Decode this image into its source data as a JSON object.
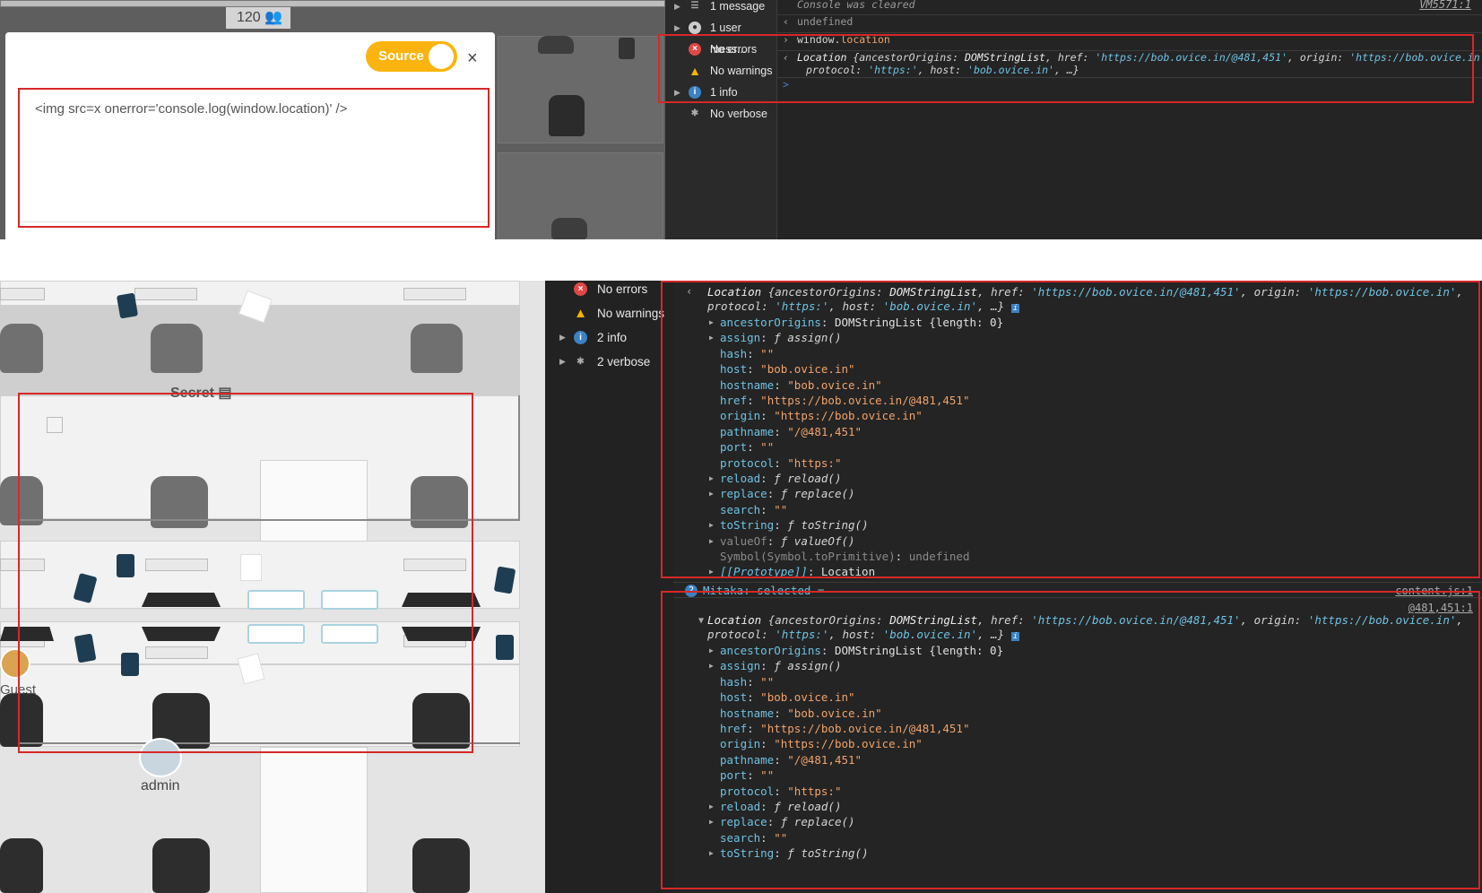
{
  "top": {
    "counter": "120",
    "editor": {
      "source_label": "Source",
      "close": "×",
      "code": "<img src=x onerror='console.log(window.location)' />"
    },
    "sidebar": [
      {
        "label": "1 message",
        "icon": "list-icon",
        "caret": true
      },
      {
        "label": "1 user mess...",
        "icon": "user-icon",
        "caret": true
      },
      {
        "label": "No errors",
        "icon": "error-icon",
        "caret": false
      },
      {
        "label": "No warnings",
        "icon": "warning-icon",
        "caret": false
      },
      {
        "label": "1 info",
        "icon": "info-icon",
        "caret": true
      },
      {
        "label": "No verbose",
        "icon": "bug-icon",
        "caret": false
      }
    ],
    "console": {
      "cleared": "Console was cleared",
      "cleared_src": "VM5571:1",
      "undefined": "undefined",
      "input_obj": "window.",
      "input_prop": "location",
      "result_line1_a": "Location",
      "result_line1_b": "{ancestorOrigins: ",
      "result_line1_c": "DOMStringList",
      "result_line1_d": ", href: ",
      "result_line1_e": "'https://bob.ovice.in/@481,451'",
      "result_line1_f": ", origin: ",
      "result_line1_g": "'https://bob.ovice.in'",
      "result_line1_h": ",",
      "result_line2_a": "protocol: ",
      "result_line2_b": "'https:'",
      "result_line2_c": ", host: ",
      "result_line2_d": "'bob.ovice.in'",
      "result_line2_e": ", …}",
      "prompt": ">"
    }
  },
  "bottom": {
    "office": {
      "secret_label": "Secret",
      "guest_label": "Guest",
      "admin_label": "admin"
    },
    "sidebar": [
      {
        "label": "No errors",
        "icon": "error-icon",
        "caret": false
      },
      {
        "label": "No warnings",
        "icon": "warning-icon",
        "caret": false
      },
      {
        "label": "2 info",
        "icon": "info-icon",
        "caret": true
      },
      {
        "label": "2 verbose",
        "icon": "bug-icon",
        "caret": true
      }
    ],
    "group_label": "Mitaka: selected =",
    "group_count": "2",
    "group_src": "content.js:1",
    "second_src": "@481,451:1",
    "summary": {
      "a": "Location",
      "b": "{ancestorOrigins: ",
      "c": "DOMStringList",
      "d": ", href: ",
      "e": "'https://bob.ovice.in/@481,451'",
      "f": ", origin: ",
      "g": "'https://bob.ovice.in'",
      "h": ",",
      "p1": "protocol: ",
      "p2": "'https:'",
      "p3": ", host: ",
      "p4": "'bob.ovice.in'",
      "p5": ", …}"
    },
    "props_block1": [
      {
        "key": "ancestorOrigins",
        "sep": ": ",
        "val": "DOMStringList {length: 0}",
        "kind": "obj",
        "caret": true
      },
      {
        "key": "assign",
        "sep": ": ",
        "val": "ƒ assign()",
        "kind": "fn",
        "caret": true
      },
      {
        "key": "hash",
        "sep": ": ",
        "val": "\"\"",
        "kind": "str",
        "caret": false
      },
      {
        "key": "host",
        "sep": ": ",
        "val": "\"bob.ovice.in\"",
        "kind": "str",
        "caret": false
      },
      {
        "key": "hostname",
        "sep": ": ",
        "val": "\"bob.ovice.in\"",
        "kind": "str",
        "caret": false
      },
      {
        "key": "href",
        "sep": ": ",
        "val": "\"https://bob.ovice.in/@481,451\"",
        "kind": "str",
        "caret": false
      },
      {
        "key": "origin",
        "sep": ": ",
        "val": "\"https://bob.ovice.in\"",
        "kind": "str",
        "caret": false
      },
      {
        "key": "pathname",
        "sep": ": ",
        "val": "\"/@481,451\"",
        "kind": "str",
        "caret": false
      },
      {
        "key": "port",
        "sep": ": ",
        "val": "\"\"",
        "kind": "str",
        "caret": false
      },
      {
        "key": "protocol",
        "sep": ": ",
        "val": "\"https:\"",
        "kind": "str",
        "caret": false
      },
      {
        "key": "reload",
        "sep": ": ",
        "val": "ƒ reload()",
        "kind": "fn",
        "caret": true
      },
      {
        "key": "replace",
        "sep": ": ",
        "val": "ƒ replace()",
        "kind": "fn",
        "caret": true
      },
      {
        "key": "search",
        "sep": ": ",
        "val": "\"\"",
        "kind": "str",
        "caret": false
      },
      {
        "key": "toString",
        "sep": ": ",
        "val": "ƒ toString()",
        "kind": "fn",
        "caret": true
      },
      {
        "key": "valueOf",
        "sep": ": ",
        "val": "ƒ valueOf()",
        "kind": "fn-dim",
        "caret": true
      },
      {
        "key": "Symbol(Symbol.toPrimitive)",
        "sep": ": ",
        "val": "undefined",
        "kind": "dim",
        "caret": false
      },
      {
        "key": "[[Prototype]]",
        "sep": ": ",
        "val": "Location",
        "kind": "proto",
        "caret": true
      }
    ],
    "props_block2": [
      {
        "key": "ancestorOrigins",
        "sep": ": ",
        "val": "DOMStringList {length: 0}",
        "kind": "obj",
        "caret": true
      },
      {
        "key": "assign",
        "sep": ": ",
        "val": "ƒ assign()",
        "kind": "fn",
        "caret": true
      },
      {
        "key": "hash",
        "sep": ": ",
        "val": "\"\"",
        "kind": "str",
        "caret": false
      },
      {
        "key": "host",
        "sep": ": ",
        "val": "\"bob.ovice.in\"",
        "kind": "str",
        "caret": false
      },
      {
        "key": "hostname",
        "sep": ": ",
        "val": "\"bob.ovice.in\"",
        "kind": "str",
        "caret": false
      },
      {
        "key": "href",
        "sep": ": ",
        "val": "\"https://bob.ovice.in/@481,451\"",
        "kind": "str",
        "caret": false
      },
      {
        "key": "origin",
        "sep": ": ",
        "val": "\"https://bob.ovice.in\"",
        "kind": "str",
        "caret": false
      },
      {
        "key": "pathname",
        "sep": ": ",
        "val": "\"/@481,451\"",
        "kind": "str",
        "caret": false
      },
      {
        "key": "port",
        "sep": ": ",
        "val": "\"\"",
        "kind": "str",
        "caret": false
      },
      {
        "key": "protocol",
        "sep": ": ",
        "val": "\"https:\"",
        "kind": "str",
        "caret": false
      },
      {
        "key": "reload",
        "sep": ": ",
        "val": "ƒ reload()",
        "kind": "fn",
        "caret": true
      },
      {
        "key": "replace",
        "sep": ": ",
        "val": "ƒ replace()",
        "kind": "fn",
        "caret": true
      },
      {
        "key": "search",
        "sep": ": ",
        "val": "\"\"",
        "kind": "str",
        "caret": false
      },
      {
        "key": "toString",
        "sep": ": ",
        "val": "ƒ toString()",
        "kind": "fn",
        "caret": true
      }
    ]
  },
  "colors": {
    "highlight": "#d62828",
    "toggle": "#fbb40f",
    "key": "#6fc2e3",
    "string": "#f0a36b"
  }
}
